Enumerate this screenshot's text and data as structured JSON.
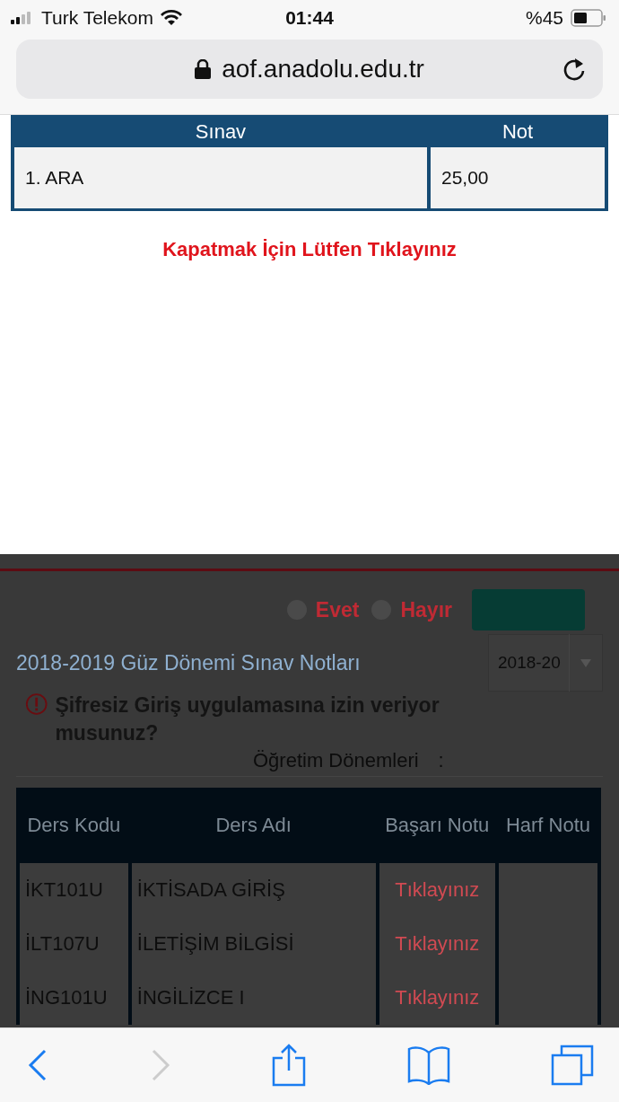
{
  "status_bar": {
    "carrier": "Turk Telekom",
    "time": "01:44",
    "battery_text": "%45"
  },
  "address_bar": {
    "url": "aof.anadolu.edu.tr"
  },
  "popup": {
    "table": {
      "columns": [
        "Sınav",
        "Not"
      ],
      "rows": [
        [
          "1. ARA",
          "25,00"
        ]
      ]
    },
    "close_link": "Kapatmak İçin Lütfen Tıklayınız"
  },
  "background_page": {
    "radio_options": [
      {
        "label": "Evet",
        "selected": false
      },
      {
        "label": "Hayır",
        "selected": false
      }
    ],
    "title": "2018-2019 Güz Dönemi Sınav Notları",
    "semester_select": {
      "value": "2018-20"
    },
    "warning": "Şifresiz Giriş uygulamasına izin veriyor musunuz?",
    "semester_label": "Öğretim Dönemleri",
    "semester_colon": ":",
    "table": {
      "columns": [
        "Ders Kodu",
        "Ders Adı",
        "Başarı Notu",
        "Harf Notu"
      ],
      "rows": [
        {
          "code": "İKT101U",
          "name": "İKTİSADA GİRİŞ",
          "grade_link": "Tıklayınız"
        },
        {
          "code": "İLT107U",
          "name": "İLETİŞİM BİLGİSİ",
          "grade_link": "Tıklayınız"
        },
        {
          "code": "İNG101U",
          "name": "İNGİLİZCE I",
          "grade_link": "Tıklayınız"
        }
      ]
    }
  }
}
